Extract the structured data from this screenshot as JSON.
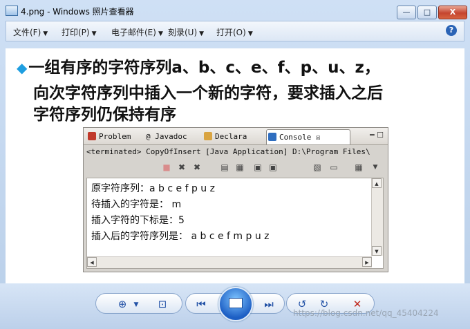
{
  "window": {
    "title": "4.png - Windows 照片查看器",
    "controls": {
      "minimize": "—",
      "maximize": "□",
      "close": "X"
    }
  },
  "menubar": {
    "items": [
      {
        "label": "文件(F)"
      },
      {
        "label": "打印(P)"
      },
      {
        "label": "电子邮件(E)"
      },
      {
        "label": "刻录(U)"
      },
      {
        "label": "打开(O)"
      }
    ],
    "help": "?"
  },
  "slide": {
    "bullet": "◆",
    "line1": "一组有序的字符序列a、b、c、e、f、p、u、z，",
    "line2": "向次字符序列中插入一个新的字符，要求插入之后",
    "line3": "字符序列仍保持有序"
  },
  "eclipse": {
    "tabs": [
      {
        "label": "Problem"
      },
      {
        "label": "@ Javadoc"
      },
      {
        "label": "Declara"
      },
      {
        "label": "Console ☒"
      }
    ],
    "terminated": "<terminated> CopyOfInsert [Java Application] D:\\Program Files\\",
    "console_lines": [
      "原字符序列：a b c e f p u z",
      "待插入的字符是： m",
      "插入字符的下标是：5",
      "插入后的字符序列是： a b c e f m p u z"
    ]
  },
  "watermark": "https://blog.csdn.net/qq_45404224"
}
